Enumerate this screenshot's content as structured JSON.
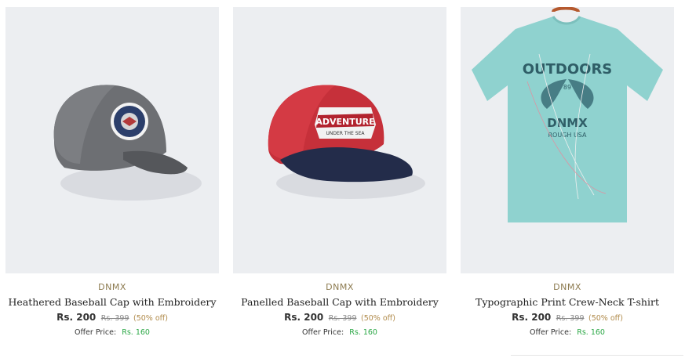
{
  "products": [
    {
      "brand": "DNMX",
      "title": "Heathered Baseball Cap with Embroidery",
      "price": "Rs. 200",
      "mrp": "Rs. 399",
      "discount": "(50% off)",
      "offer_label": "Offer Price:",
      "offer_price": "Rs. 160",
      "image_icon": "grey-cap-image"
    },
    {
      "brand": "DNMX",
      "title": "Panelled Baseball Cap with Embroidery",
      "price": "Rs. 200",
      "mrp": "Rs. 399",
      "discount": "(50% off)",
      "offer_label": "Offer Price:",
      "offer_price": "Rs. 160",
      "image_icon": "red-navy-cap-image",
      "patch_lines": [
        "ADVENTURE",
        "UNDER THE SEA"
      ]
    },
    {
      "brand": "DNMX",
      "title": "Typographic Print Crew-Neck T-shirt",
      "price": "Rs. 200",
      "mrp": "Rs. 399",
      "discount": "(50% off)",
      "offer_label": "Offer Price:",
      "offer_price": "Rs. 160",
      "image_icon": "teal-tshirt-image",
      "print_lines": [
        "OUTDOORS",
        "89",
        "DNMX",
        "ROUGH USA"
      ]
    }
  ],
  "colors": {
    "brand": "#8c7a4f",
    "discount": "#b08a4a",
    "offer_price": "#2aa745",
    "image_bg": "#eceef1"
  }
}
